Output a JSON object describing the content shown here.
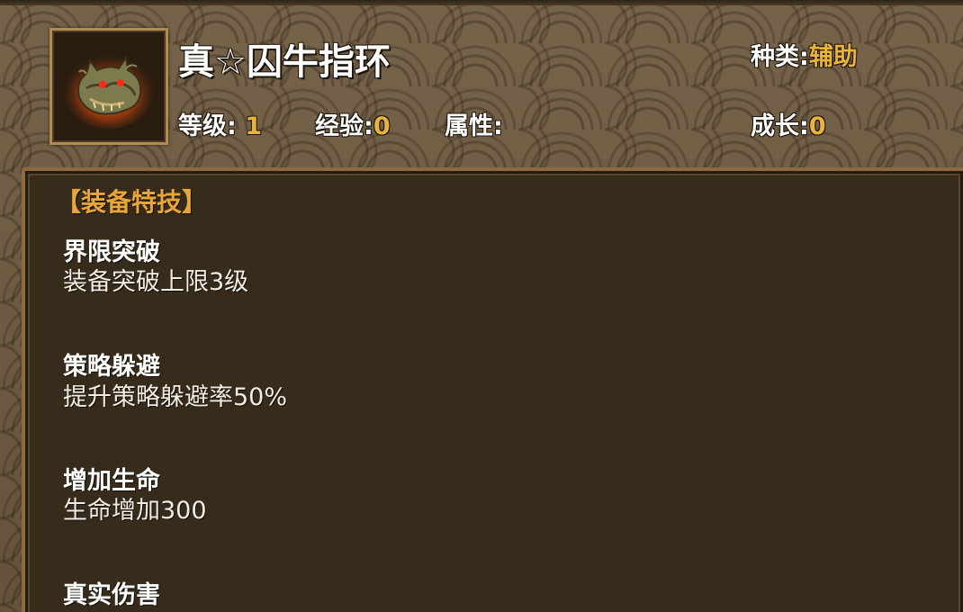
{
  "item": {
    "title": "真☆囚牛指环",
    "icon": "dragon-head-ring-icon"
  },
  "stats": {
    "level_label": "等级:",
    "level_value": "1",
    "exp_label": "经验:",
    "exp_value": "0",
    "attribute_label": "属性:",
    "attribute_value": "",
    "type_label": "种类:",
    "type_value": "辅助",
    "growth_label": "成长:",
    "growth_value": "0"
  },
  "skills_section": {
    "header": "【装备特技】",
    "skills": [
      {
        "name": "界限突破",
        "desc": "装备突破上限3级"
      },
      {
        "name": "策略躲避",
        "desc": "提升策略躲避率50%"
      },
      {
        "name": "增加生命",
        "desc": "生命增加300"
      },
      {
        "name": "真实伤害",
        "desc": ""
      }
    ]
  },
  "colors": {
    "accent": "#e8b43c",
    "header": "#e8a63a",
    "panel_bg": "#372c1c",
    "frame": "#b08a4e"
  }
}
